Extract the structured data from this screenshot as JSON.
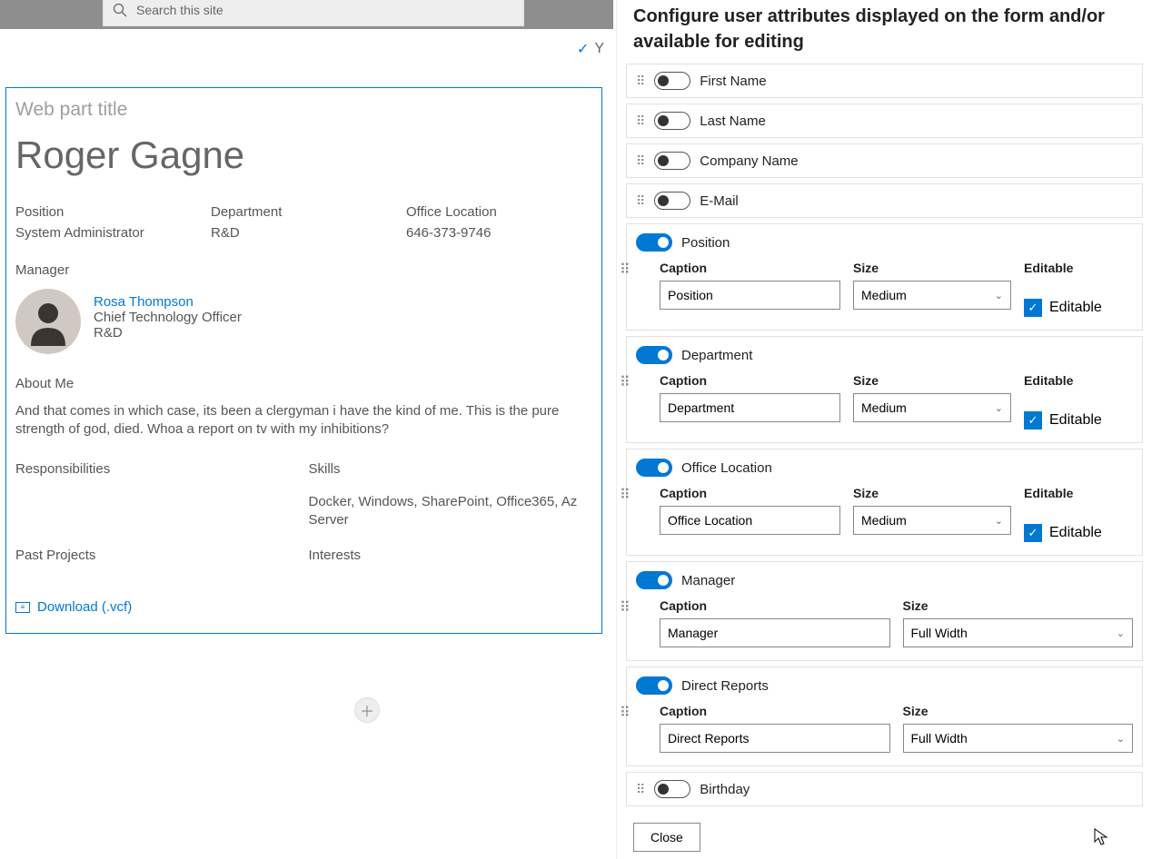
{
  "search": {
    "placeholder": "Search this site"
  },
  "webpart": {
    "title_placeholder": "Web part title",
    "user_name": "Roger Gagne",
    "position_label": "Position",
    "position_value": "System Administrator",
    "department_label": "Department",
    "department_value": "R&D",
    "office_label": "Office Location",
    "office_value": "646-373-9746",
    "manager_label": "Manager",
    "manager": {
      "name": "Rosa Thompson",
      "title": "Chief Technology Officer",
      "dept": "R&D"
    },
    "about_label": "About Me",
    "about_text": "And that comes in which case, its been a clergyman i have the kind of me. This is the pure strength of god, died. Whoa a report on tv with my inhibitions?",
    "responsibilities_label": "Responsibilities",
    "skills_label": "Skills",
    "skills_value": "Docker, Windows, SharePoint, Office365, Az Server",
    "past_projects_label": "Past Projects",
    "interests_label": "Interests",
    "download_label": "Download (.vcf)"
  },
  "panel": {
    "header": "Configure user attributes displayed on the form and/or available for editing",
    "caption_label": "Caption",
    "size_label": "Size",
    "editable_label": "Editable",
    "close_label": "Close",
    "attrs": [
      {
        "name": "First Name",
        "on": false
      },
      {
        "name": "Last Name",
        "on": false
      },
      {
        "name": "Company Name",
        "on": false
      },
      {
        "name": "E-Mail",
        "on": false
      },
      {
        "name": "Position",
        "on": true,
        "caption": "Position",
        "size": "Medium",
        "editable": true
      },
      {
        "name": "Department",
        "on": true,
        "caption": "Department",
        "size": "Medium",
        "editable": true
      },
      {
        "name": "Office Location",
        "on": true,
        "caption": "Office Location",
        "size": "Medium",
        "editable": true
      },
      {
        "name": "Manager",
        "on": true,
        "caption": "Manager",
        "size": "Full Width"
      },
      {
        "name": "Direct Reports",
        "on": true,
        "caption": "Direct Reports",
        "size": "Full Width"
      },
      {
        "name": "Birthday",
        "on": false
      }
    ]
  }
}
